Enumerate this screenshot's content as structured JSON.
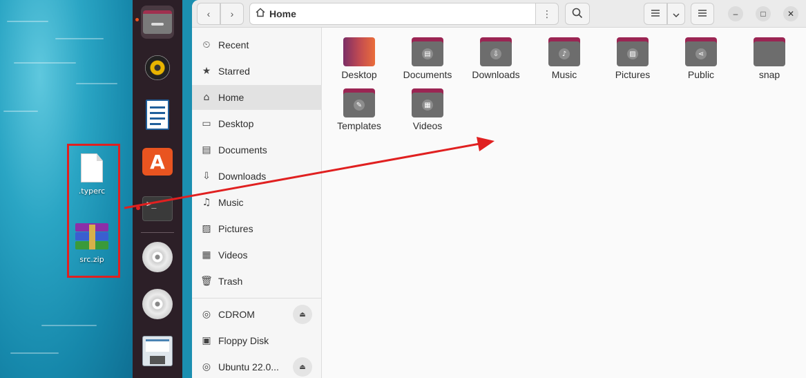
{
  "desktop": {
    "icons": [
      {
        "label": ".typerc"
      },
      {
        "label": "src.zip"
      }
    ]
  },
  "dock": {
    "items": [
      "files-icon",
      "rhythmbox-icon",
      "libreoffice-writer-icon",
      "app-center-icon",
      "terminal-icon",
      "disc-icon",
      "disc-icon",
      "save-icon"
    ],
    "accent": "#e95420"
  },
  "header": {
    "path_label": "Home",
    "back_glyph": "‹",
    "forward_glyph": "›",
    "menu_glyph": "⋮",
    "search_glyph": "⌕",
    "minimize_glyph": "–",
    "maximize_glyph": "□",
    "close_glyph": "✕"
  },
  "sidebar": {
    "items": [
      {
        "label": "Recent",
        "icon": "⏲"
      },
      {
        "label": "Starred",
        "icon": "★"
      },
      {
        "label": "Home",
        "icon": "⌂"
      },
      {
        "label": "Desktop",
        "icon": "▭"
      },
      {
        "label": "Documents",
        "icon": "▤"
      },
      {
        "label": "Downloads",
        "icon": "⇩"
      },
      {
        "label": "Music",
        "icon": "♫"
      },
      {
        "label": "Pictures",
        "icon": "▨"
      },
      {
        "label": "Videos",
        "icon": "▦"
      },
      {
        "label": "Trash",
        "icon": "🗑"
      }
    ],
    "devices": [
      {
        "label": "CDROM",
        "icon": "◎",
        "eject": "⏏"
      },
      {
        "label": "Floppy Disk",
        "icon": "▣"
      },
      {
        "label": "Ubuntu 22.0...",
        "icon": "◎",
        "eject": "⏏"
      }
    ]
  },
  "content": {
    "folders": [
      {
        "label": "Desktop",
        "sym": ""
      },
      {
        "label": "Documents",
        "sym": "▤"
      },
      {
        "label": "Downloads",
        "sym": "⇩"
      },
      {
        "label": "Music",
        "sym": "♪"
      },
      {
        "label": "Pictures",
        "sym": "▨"
      },
      {
        "label": "Public",
        "sym": "⋖"
      },
      {
        "label": "snap",
        "sym": ""
      },
      {
        "label": "Templates",
        "sym": "✎"
      },
      {
        "label": "Videos",
        "sym": "▦"
      }
    ]
  },
  "colors": {
    "folder_tab": "#9b2553",
    "folder_body": "#6d6d6d",
    "annotation": "#e02020"
  }
}
